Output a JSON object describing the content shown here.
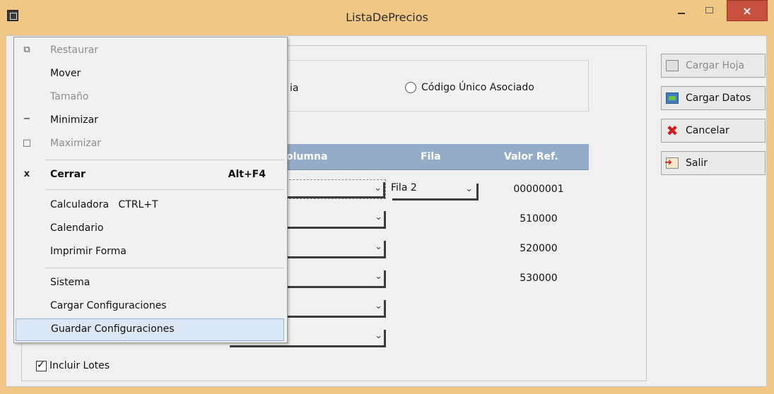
{
  "window": {
    "title": "ListaDePrecios",
    "close_glyph": "×"
  },
  "dialog": {
    "radio_partial_text": "ia",
    "radio_label": "Código Único Asociado",
    "grid": {
      "headers": {
        "columna": "olumna",
        "fila": "Fila",
        "valor": "Valor Ref."
      },
      "rows": [
        {
          "fila": "Fila 2",
          "valor": "00000001"
        },
        {
          "fila": "",
          "valor": "510000"
        },
        {
          "fila": "",
          "valor": "520000"
        },
        {
          "fila": "",
          "valor": "530000"
        },
        {
          "fila": "",
          "valor": ""
        },
        {
          "fila": "",
          "valor": ""
        }
      ]
    },
    "checkbox": {
      "label": "Incluir Lotes",
      "checked": true
    }
  },
  "buttons": {
    "cargar_hoja": "Cargar Hoja",
    "cargar_datos": "Cargar Datos",
    "cancelar": "Cancelar",
    "salir": "Salir"
  },
  "system_menu": {
    "items": [
      {
        "label": "Restaurar",
        "icon": "restore-icon",
        "disabled": true
      },
      {
        "label": "Mover"
      },
      {
        "label": "Tamaño",
        "disabled": true
      },
      {
        "label": "Minimizar",
        "icon": "minimize-icon"
      },
      {
        "label": "Maximizar",
        "icon": "maximize-icon",
        "disabled": true
      },
      {
        "label": "Cerrar",
        "accelerator": "Alt+F4",
        "icon": "close-icon",
        "bold": true
      },
      {
        "label": "Calculadora   CTRL+T"
      },
      {
        "label": "Calendario"
      },
      {
        "label": "Imprimir Forma"
      },
      {
        "label": "Sistema"
      },
      {
        "label": "Cargar Configuraciones"
      },
      {
        "label": "Guardar Configuraciones",
        "selected": true
      }
    ]
  },
  "icons": {
    "restore": "⧉",
    "minimize": "−",
    "maximize": "□",
    "close": "x",
    "dropdown": "⌄"
  },
  "colors": {
    "title_bar": "#f0c785",
    "grid_header": "#95acc8",
    "close_button": "#c7503f",
    "menu_selection": "#dbe7f4"
  }
}
